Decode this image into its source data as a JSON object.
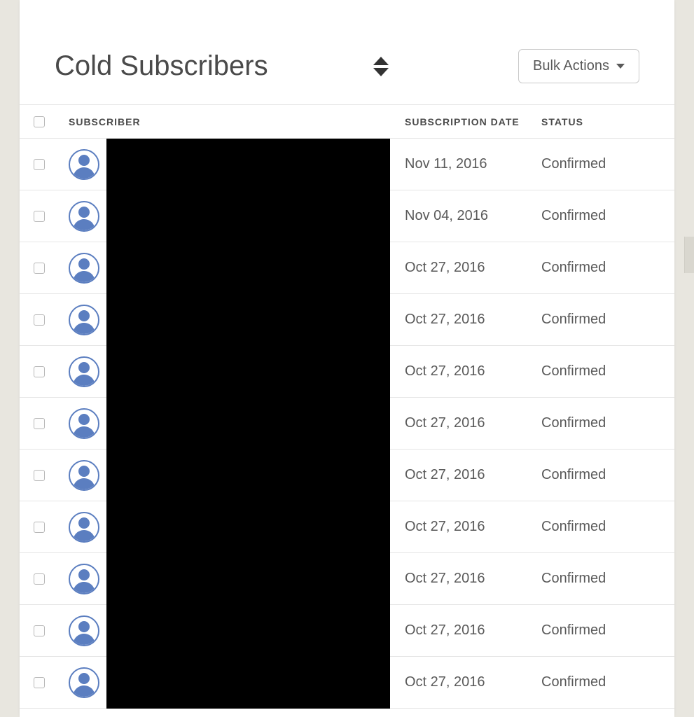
{
  "header": {
    "title": "Cold Subscribers",
    "bulk_actions_label": "Bulk Actions"
  },
  "table": {
    "headers": {
      "subscriber": "SUBSCRIBER",
      "subscription_date": "SUBSCRIPTION DATE",
      "status": "STATUS"
    },
    "rows": [
      {
        "date": "Nov 11, 2016",
        "status": "Confirmed"
      },
      {
        "date": "Nov 04, 2016",
        "status": "Confirmed"
      },
      {
        "date": "Oct 27, 2016",
        "status": "Confirmed"
      },
      {
        "date": "Oct 27, 2016",
        "status": "Confirmed"
      },
      {
        "date": "Oct 27, 2016",
        "status": "Confirmed"
      },
      {
        "date": "Oct 27, 2016",
        "status": "Confirmed"
      },
      {
        "date": "Oct 27, 2016",
        "status": "Confirmed"
      },
      {
        "date": "Oct 27, 2016",
        "status": "Confirmed"
      },
      {
        "date": "Oct 27, 2016",
        "status": "Confirmed"
      },
      {
        "date": "Oct 27, 2016",
        "status": "Confirmed"
      },
      {
        "date": "Oct 27, 2016",
        "status": "Confirmed"
      }
    ]
  }
}
